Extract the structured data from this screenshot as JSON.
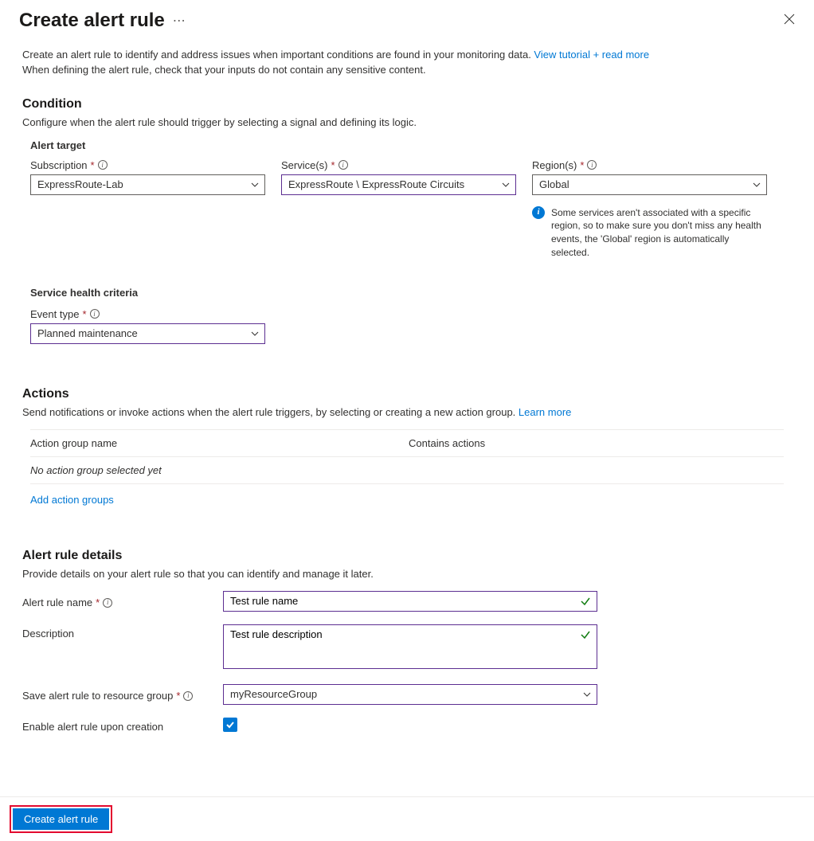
{
  "header": {
    "title": "Create alert rule"
  },
  "intro": {
    "line1": "Create an alert rule to identify and address issues when important conditions are found in your monitoring data. ",
    "link": "View tutorial + read more",
    "line2": "When defining the alert rule, check that your inputs do not contain any sensitive content."
  },
  "condition": {
    "heading": "Condition",
    "desc": "Configure when the alert rule should trigger by selecting a signal and defining its logic.",
    "alert_target_heading": "Alert target",
    "subscription": {
      "label": "Subscription",
      "value": "ExpressRoute-Lab"
    },
    "services": {
      "label": "Service(s)",
      "value": "ExpressRoute \\ ExpressRoute Circuits"
    },
    "regions": {
      "label": "Region(s)",
      "value": "Global"
    },
    "region_info": "Some services aren't associated with a specific region, so to make sure you don't miss any health events, the 'Global' region is automatically selected.",
    "criteria_heading": "Service health criteria",
    "event_type": {
      "label": "Event type",
      "value": "Planned maintenance"
    }
  },
  "actions": {
    "heading": "Actions",
    "desc": "Send notifications or invoke actions when the alert rule triggers, by selecting or creating a new action group. ",
    "learn_more": "Learn more",
    "col1": "Action group name",
    "col2": "Contains actions",
    "empty": "No action group selected yet",
    "add_link": "Add action groups"
  },
  "details": {
    "heading": "Alert rule details",
    "desc": "Provide details on your alert rule so that you can identify and manage it later.",
    "name": {
      "label": "Alert rule name",
      "value": "Test rule name"
    },
    "description": {
      "label": "Description",
      "value": "Test rule description"
    },
    "resource_group": {
      "label": "Save alert rule to resource group",
      "value": "myResourceGroup"
    },
    "enable": {
      "label": "Enable alert rule upon creation",
      "checked": true
    }
  },
  "footer": {
    "create_label": "Create alert rule"
  }
}
